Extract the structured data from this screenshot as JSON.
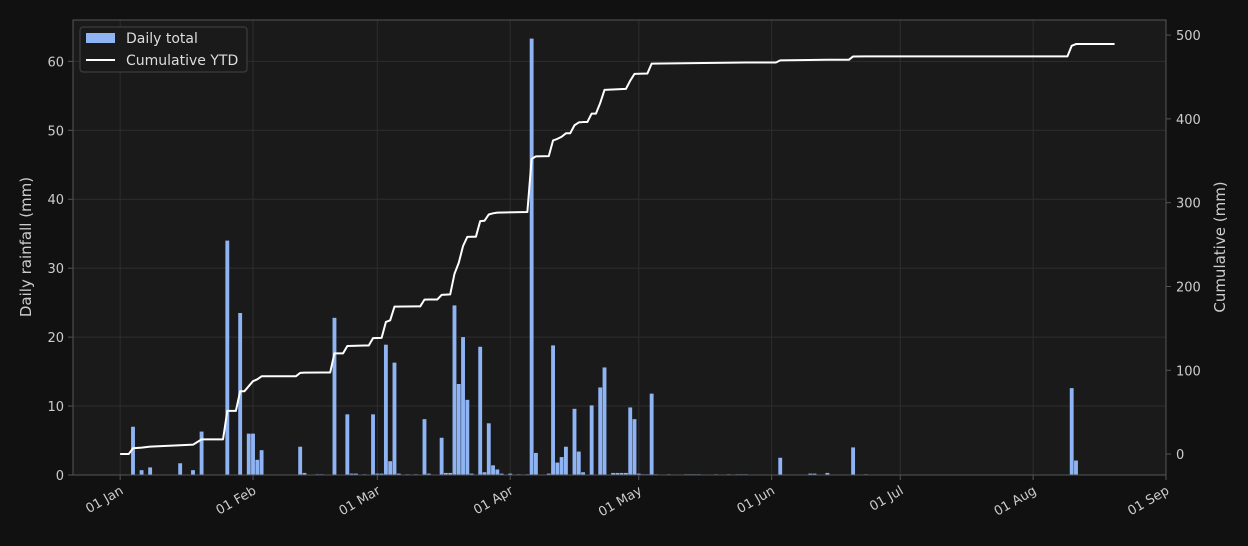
{
  "chart_data": {
    "type": "bar",
    "title": "",
    "xlabel": "",
    "ylabel": "Daily rainfall (mm)",
    "y2label": "Cumulative (mm)",
    "ylim": [
      0,
      66
    ],
    "y2lim": [
      -25,
      518
    ],
    "y_ticks": [
      0,
      10,
      20,
      30,
      40,
      50,
      60
    ],
    "y2_ticks": [
      0,
      100,
      200,
      300,
      400,
      500
    ],
    "x_range": [
      "2023-12-21",
      "2024-09-01"
    ],
    "x_ticks": [
      {
        "date": "2024-01-01",
        "label": "01 Jan"
      },
      {
        "date": "2024-02-01",
        "label": "01 Feb"
      },
      {
        "date": "2024-03-01",
        "label": "01 Mar"
      },
      {
        "date": "2024-04-01",
        "label": "01 Apr"
      },
      {
        "date": "2024-05-01",
        "label": "01 May"
      },
      {
        "date": "2024-06-01",
        "label": "01 Jun"
      },
      {
        "date": "2024-07-01",
        "label": "01 Jul"
      },
      {
        "date": "2024-08-01",
        "label": "01 Aug"
      },
      {
        "date": "2024-09-01",
        "label": "01 Sep"
      }
    ],
    "grid": true,
    "legend_position": "top-left",
    "colors": {
      "background": "#111111",
      "plot_background": "#1a1a1a",
      "bars": "#8fb4f4",
      "line": "#ffffff",
      "grid": "#2e2e2e",
      "axis": "#555555",
      "text": "#cccccc"
    },
    "series": [
      {
        "name": "Daily total",
        "kind": "bar",
        "axis": "left",
        "points": [
          [
            "2024-01-04",
            7.0
          ],
          [
            "2024-01-06",
            0.7
          ],
          [
            "2024-01-08",
            1.1
          ],
          [
            "2024-01-15",
            1.7
          ],
          [
            "2024-01-18",
            0.7
          ],
          [
            "2024-01-20",
            6.3
          ],
          [
            "2024-01-26",
            34.0
          ],
          [
            "2024-01-29",
            23.5
          ],
          [
            "2024-01-31",
            6.0
          ],
          [
            "2024-02-01",
            6.0
          ],
          [
            "2024-02-02",
            2.2
          ],
          [
            "2024-02-03",
            3.6
          ],
          [
            "2024-02-12",
            4.1
          ],
          [
            "2024-02-13",
            0.3
          ],
          [
            "2024-02-16",
            0.1
          ],
          [
            "2024-02-17",
            0.1
          ],
          [
            "2024-02-20",
            22.8
          ],
          [
            "2024-02-23",
            8.8
          ],
          [
            "2024-02-24",
            0.2
          ],
          [
            "2024-02-25",
            0.2
          ],
          [
            "2024-02-27",
            0.1
          ],
          [
            "2024-02-29",
            8.8
          ],
          [
            "2024-03-01",
            0.2
          ],
          [
            "2024-03-02",
            0.2
          ],
          [
            "2024-03-03",
            18.9
          ],
          [
            "2024-03-04",
            2.0
          ],
          [
            "2024-03-05",
            16.3
          ],
          [
            "2024-03-06",
            0.2
          ],
          [
            "2024-03-08",
            0.1
          ],
          [
            "2024-03-10",
            0.1
          ],
          [
            "2024-03-12",
            8.1
          ],
          [
            "2024-03-13",
            0.2
          ],
          [
            "2024-03-16",
            5.4
          ],
          [
            "2024-03-17",
            0.3
          ],
          [
            "2024-03-18",
            0.3
          ],
          [
            "2024-03-19",
            24.6
          ],
          [
            "2024-03-20",
            13.2
          ],
          [
            "2024-03-21",
            20.0
          ],
          [
            "2024-03-22",
            10.9
          ],
          [
            "2024-03-23",
            0.2
          ],
          [
            "2024-03-25",
            18.6
          ],
          [
            "2024-03-26",
            0.4
          ],
          [
            "2024-03-27",
            7.5
          ],
          [
            "2024-03-28",
            1.4
          ],
          [
            "2024-03-29",
            0.8
          ],
          [
            "2024-03-30",
            0.2
          ],
          [
            "2024-04-01",
            0.2
          ],
          [
            "2024-04-03",
            0.1
          ],
          [
            "2024-04-05",
            0.1
          ],
          [
            "2024-04-06",
            63.3
          ],
          [
            "2024-04-07",
            3.2
          ],
          [
            "2024-04-10",
            0.2
          ],
          [
            "2024-04-11",
            18.8
          ],
          [
            "2024-04-12",
            1.8
          ],
          [
            "2024-04-13",
            2.6
          ],
          [
            "2024-04-14",
            4.1
          ],
          [
            "2024-04-16",
            9.6
          ],
          [
            "2024-04-17",
            3.4
          ],
          [
            "2024-04-18",
            0.4
          ],
          [
            "2024-04-20",
            10.1
          ],
          [
            "2024-04-22",
            12.7
          ],
          [
            "2024-04-23",
            15.6
          ],
          [
            "2024-04-25",
            0.3
          ],
          [
            "2024-04-26",
            0.3
          ],
          [
            "2024-04-27",
            0.3
          ],
          [
            "2024-04-28",
            0.3
          ],
          [
            "2024-04-29",
            9.8
          ],
          [
            "2024-04-30",
            8.1
          ],
          [
            "2024-05-01",
            0.2
          ],
          [
            "2024-05-02",
            0.1
          ],
          [
            "2024-05-03",
            0.1
          ],
          [
            "2024-05-04",
            11.8
          ],
          [
            "2024-05-05",
            0.1
          ],
          [
            "2024-05-08",
            0.1
          ],
          [
            "2024-05-12",
            0.1
          ],
          [
            "2024-05-13",
            0.1
          ],
          [
            "2024-05-14",
            0.1
          ],
          [
            "2024-05-15",
            0.1
          ],
          [
            "2024-05-19",
            0.1
          ],
          [
            "2024-05-22",
            0.1
          ],
          [
            "2024-05-24",
            0.1
          ],
          [
            "2024-05-25",
            0.1
          ],
          [
            "2024-05-26",
            0.1
          ],
          [
            "2024-06-03",
            2.5
          ],
          [
            "2024-06-10",
            0.2
          ],
          [
            "2024-06-11",
            0.2
          ],
          [
            "2024-06-14",
            0.3
          ],
          [
            "2024-06-20",
            4.0
          ],
          [
            "2024-06-23",
            0.1
          ],
          [
            "2024-08-10",
            12.6
          ],
          [
            "2024-08-11",
            2.1
          ]
        ]
      },
      {
        "name": "Cumulative YTD",
        "kind": "line",
        "axis": "right",
        "points": [
          [
            "2024-01-01",
            0
          ],
          [
            "2024-01-03",
            0
          ],
          [
            "2024-01-04",
            7.0
          ],
          [
            "2024-01-06",
            7.7
          ],
          [
            "2024-01-08",
            8.8
          ],
          [
            "2024-01-15",
            10.5
          ],
          [
            "2024-01-18",
            11.2
          ],
          [
            "2024-01-20",
            17.5
          ],
          [
            "2024-01-25",
            17.5
          ],
          [
            "2024-01-26",
            51.5
          ],
          [
            "2024-01-28",
            51.5
          ],
          [
            "2024-01-29",
            75.0
          ],
          [
            "2024-01-30",
            75.0
          ],
          [
            "2024-01-31",
            81.0
          ],
          [
            "2024-02-01",
            87.0
          ],
          [
            "2024-02-02",
            89.2
          ],
          [
            "2024-02-03",
            92.8
          ],
          [
            "2024-02-11",
            92.8
          ],
          [
            "2024-02-12",
            96.9
          ],
          [
            "2024-02-13",
            97.2
          ],
          [
            "2024-02-17",
            97.4
          ],
          [
            "2024-02-19",
            97.4
          ],
          [
            "2024-02-20",
            120.2
          ],
          [
            "2024-02-22",
            120.2
          ],
          [
            "2024-02-23",
            129.0
          ],
          [
            "2024-02-27",
            129.5
          ],
          [
            "2024-02-28",
            129.5
          ],
          [
            "2024-02-29",
            138.3
          ],
          [
            "2024-03-02",
            138.7
          ],
          [
            "2024-03-03",
            157.6
          ],
          [
            "2024-03-04",
            159.6
          ],
          [
            "2024-03-05",
            175.9
          ],
          [
            "2024-03-10",
            176.2
          ],
          [
            "2024-03-11",
            176.2
          ],
          [
            "2024-03-12",
            184.3
          ],
          [
            "2024-03-13",
            184.5
          ],
          [
            "2024-03-15",
            184.5
          ],
          [
            "2024-03-16",
            189.9
          ],
          [
            "2024-03-18",
            190.5
          ],
          [
            "2024-03-19",
            215.1
          ],
          [
            "2024-03-20",
            228.3
          ],
          [
            "2024-03-21",
            248.3
          ],
          [
            "2024-03-22",
            259.2
          ],
          [
            "2024-03-23",
            259.4
          ],
          [
            "2024-03-24",
            259.4
          ],
          [
            "2024-03-25",
            278.0
          ],
          [
            "2024-03-26",
            278.4
          ],
          [
            "2024-03-27",
            285.9
          ],
          [
            "2024-03-28",
            287.3
          ],
          [
            "2024-03-29",
            288.1
          ],
          [
            "2024-04-05",
            288.8
          ],
          [
            "2024-04-06",
            352.1
          ],
          [
            "2024-04-07",
            355.3
          ],
          [
            "2024-04-10",
            355.5
          ],
          [
            "2024-04-11",
            374.3
          ],
          [
            "2024-04-12",
            376.1
          ],
          [
            "2024-04-13",
            378.7
          ],
          [
            "2024-04-14",
            382.8
          ],
          [
            "2024-04-15",
            382.8
          ],
          [
            "2024-04-16",
            392.4
          ],
          [
            "2024-04-17",
            395.8
          ],
          [
            "2024-04-18",
            396.2
          ],
          [
            "2024-04-19",
            396.2
          ],
          [
            "2024-04-20",
            406.3
          ],
          [
            "2024-04-21",
            406.3
          ],
          [
            "2024-04-22",
            419.0
          ],
          [
            "2024-04-23",
            434.6
          ],
          [
            "2024-04-28",
            435.8
          ],
          [
            "2024-04-29",
            445.6
          ],
          [
            "2024-04-30",
            453.7
          ],
          [
            "2024-05-03",
            454.1
          ],
          [
            "2024-05-04",
            465.9
          ],
          [
            "2024-05-26",
            467.3
          ],
          [
            "2024-06-02",
            467.3
          ],
          [
            "2024-06-03",
            469.8
          ],
          [
            "2024-06-14",
            470.5
          ],
          [
            "2024-06-19",
            470.5
          ],
          [
            "2024-06-20",
            474.5
          ],
          [
            "2024-06-23",
            474.6
          ],
          [
            "2024-08-09",
            474.6
          ],
          [
            "2024-08-10",
            487.2
          ],
          [
            "2024-08-11",
            489.3
          ],
          [
            "2024-08-20",
            489.3
          ]
        ]
      }
    ]
  }
}
